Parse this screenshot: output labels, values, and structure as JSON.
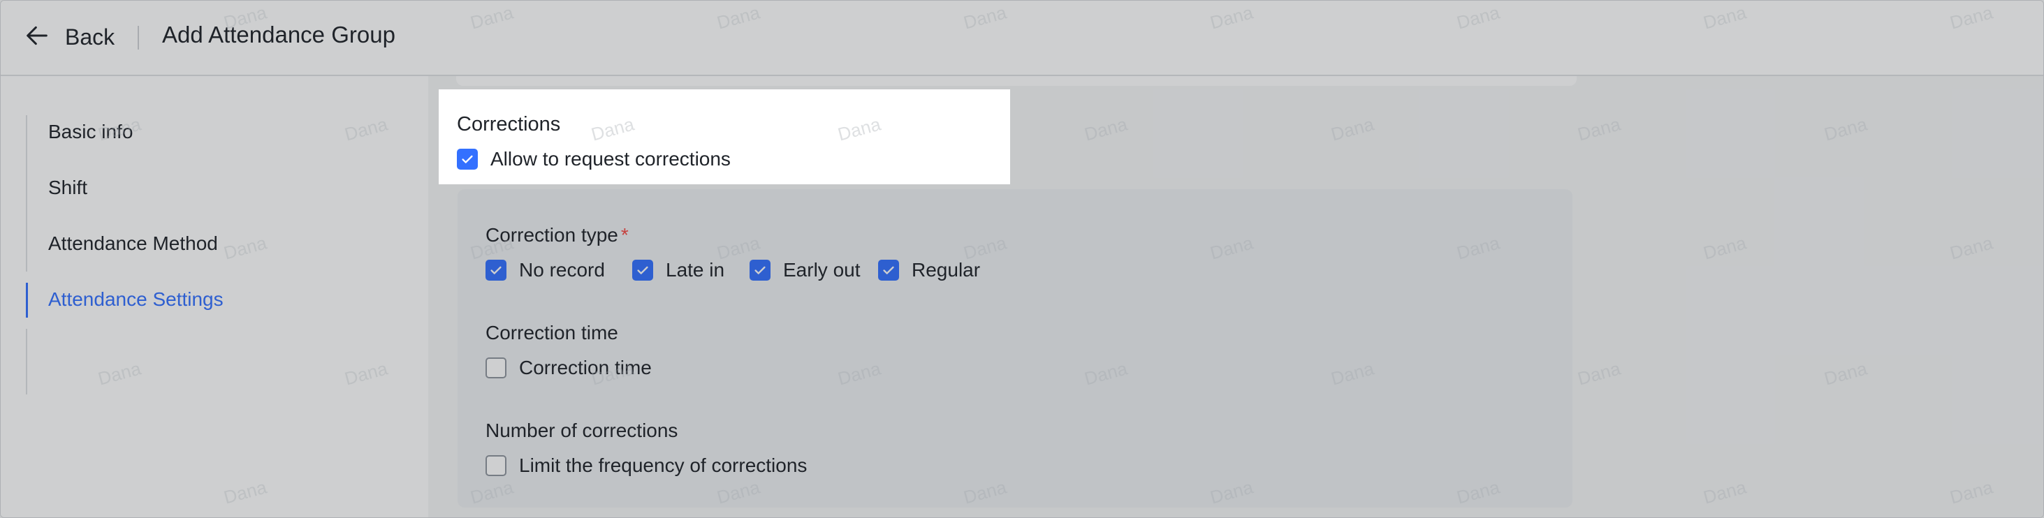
{
  "header": {
    "back_label": "Back",
    "title": "Add Attendance Group"
  },
  "sidebar": {
    "items": [
      {
        "label": "Basic info"
      },
      {
        "label": "Shift"
      },
      {
        "label": "Attendance Method"
      },
      {
        "label": "Attendance Settings",
        "active": true
      }
    ]
  },
  "corrections": {
    "title": "Corrections",
    "allow_label": "Allow to request corrections",
    "allow_checked": true,
    "correction_type": {
      "title": "Correction type",
      "required_mark": "*",
      "options": [
        {
          "label": "No record",
          "checked": true
        },
        {
          "label": "Late in",
          "checked": true
        },
        {
          "label": "Early out",
          "checked": true
        },
        {
          "label": "Regular",
          "checked": true
        }
      ]
    },
    "correction_time": {
      "title": "Correction time",
      "option_label": "Correction time",
      "checked": false
    },
    "number_of_corrections": {
      "title": "Number of corrections",
      "option_label": "Limit the frequency of corrections",
      "checked": false
    }
  },
  "watermark": "Dana",
  "colors": {
    "accent": "#3370ff",
    "required": "#f54a45",
    "text": "#1f2329"
  }
}
